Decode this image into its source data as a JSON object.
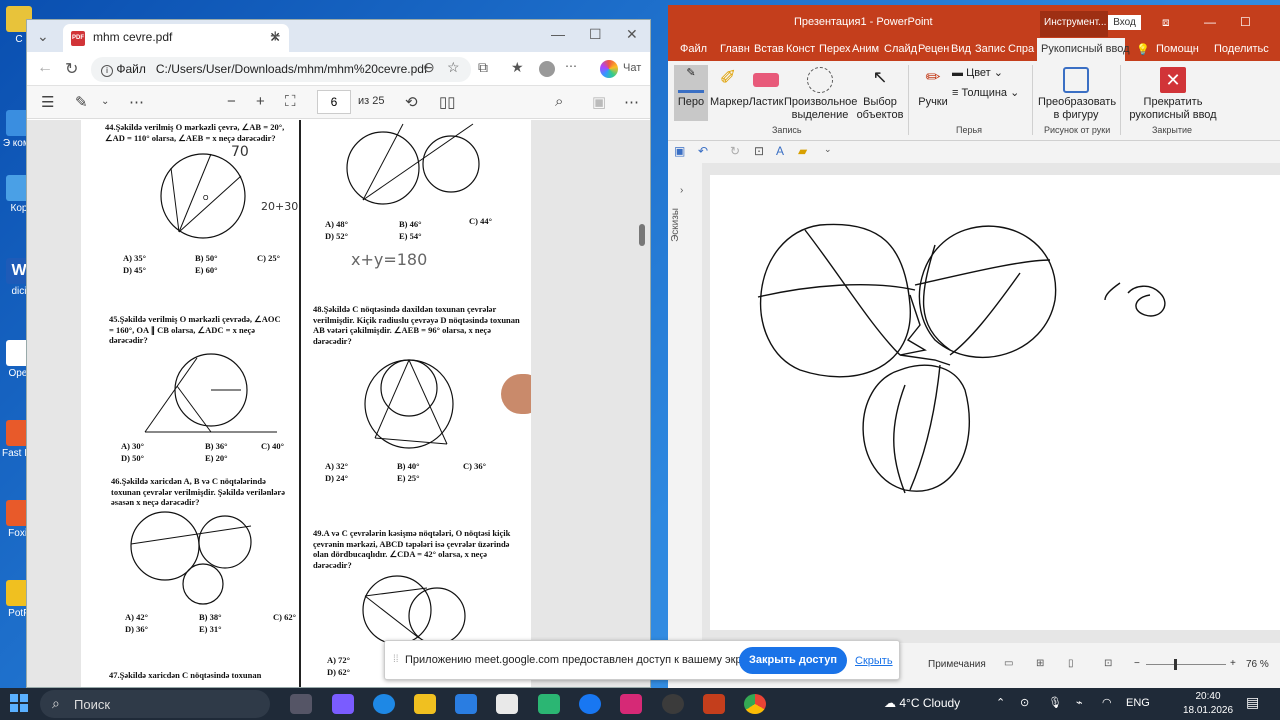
{
  "desktop": {
    "icons": [
      {
        "label": "C",
        "color": "#e8c33a"
      },
      {
        "label": "Э комп",
        "color": "#3a8ee0"
      },
      {
        "label": "Кор",
        "color": "#4aa0e6"
      },
      {
        "label": "dici",
        "color": "#1e5bb8"
      },
      {
        "label": "Opei",
        "color": "#ffffff"
      },
      {
        "label": "Fast Imag",
        "color": "#e85a2a"
      },
      {
        "label": "Foxit",
        "color": "#e85a2a"
      },
      {
        "label": "PotP",
        "color": "#f0c020"
      }
    ]
  },
  "edge": {
    "tab_title": "mhm cevre.pdf",
    "url_scheme": "Файл",
    "url": "C:/Users/User/Downloads/mhm/mhm%20cevre.pdf",
    "chat_label": "Чат",
    "page_current": "6",
    "page_total": "из 25",
    "pdf": {
      "q44": "44.Şəkildə verilmiş O mərkəzli çevrə, ∠AB = 20°, ∠AD = 110° olarsa, ∠AEB = x neçə dərəcədir?",
      "q44_answers": [
        "A) 35°",
        "B) 50°",
        "C) 25°",
        "D) 45°",
        "E) 60°"
      ],
      "q45": "45.Şəkildə verilmiş O mərkəzli çevrədə, ∠AOC = 160°, OA ∥ CB olarsa, ∠ADC = x neçə dərəcədir?",
      "q45_answers": [
        "A) 30°",
        "B) 36°",
        "C) 40°",
        "D) 50°",
        "E) 20°"
      ],
      "q46": "46.Şəkildə xaricdən A, B və C nöqtələrində toxunan çevrələr verilmişdir. Şəkildə verilənlərə əsasən x neçə dərəcədir?",
      "q46_answers": [
        "A) 42°",
        "B) 38°",
        "C) 62°",
        "D) 36°",
        "E) 31°"
      ],
      "q47": "47.Şəkildə xaricdən C nöqtəsində toxunan",
      "q43_answers": [
        "A) 48°",
        "B) 46°",
        "C) 44°",
        "D) 52°",
        "E) 54°"
      ],
      "q48": "48.Şəkildə C nöqtəsində daxildən toxunan çevrələr verilmişdir. Kiçik radiuslu çevrəyə D nöqtəsində toxunan AB vətəri çəkilmişdir. ∠AEB = 96° olarsa, x neçə dərəcədir?",
      "q48_answers": [
        "A) 32°",
        "B) 40°",
        "C) 36°",
        "D) 24°",
        "E) 25°"
      ],
      "q49": "49.A və C çevrələrin kəsişmə nöqtələri, O nöqtəsi kiçik çevrənin mərkəzi, ABCD təpələri isə çevrələr üzərində olan dördbucaqlıdır. ∠CDA = 42° olarsa, x neçə dərəcədir?",
      "q49_answers": [
        "A) 72°",
        "D) 62°"
      ],
      "handwriting_1": "x+y=180",
      "handwriting_2": "20+30",
      "handwriting_3": "70"
    }
  },
  "ppt": {
    "title": "Презентация1 - PowerPoint",
    "context_tab": "Инструмент...",
    "login": "Вход",
    "tabs": [
      "Файл",
      "Главн",
      "Встав",
      "Конст",
      "Перех",
      "Аним",
      "Слайд",
      "Рецен",
      "Вид",
      "Запис",
      "Спра"
    ],
    "active_tab": "Рукописный ввод",
    "help": "Помощн",
    "share": "Поделитьс",
    "ribbon": {
      "pen": "Перо",
      "marker": "Маркер",
      "eraser": "Ластик",
      "free_select": "Произвольное выделение",
      "select_objects": "Выбор объектов",
      "group_record": "Запись",
      "pens": "Ручки",
      "color": "Цвет",
      "thickness": "Толщина",
      "group_pens": "Перья",
      "convert": "Преобразовать в фигуру",
      "group_convert": "Рисунок от руки",
      "stop": "Прекратить рукописный ввод",
      "group_close": "Закрытие"
    },
    "thumbnails_label": "Эскизы",
    "status_notes": "Примечания",
    "zoom": "76 %"
  },
  "notification": {
    "message": "Приложению meet.google.com предоставлен доступ к вашему экрану.",
    "stop_label": "Закрыть доступ",
    "hide_label": "Скрыть"
  },
  "taskbar": {
    "search": "Поиск",
    "weather": "4°C  Cloudy",
    "lang": "ENG",
    "time": "20:40",
    "date": "18.01.2026"
  },
  "colors": {
    "ppt_accent": "#c43e1c",
    "edge_tabbar": "#dfe7f2",
    "meet_blue": "#1a73e8"
  }
}
